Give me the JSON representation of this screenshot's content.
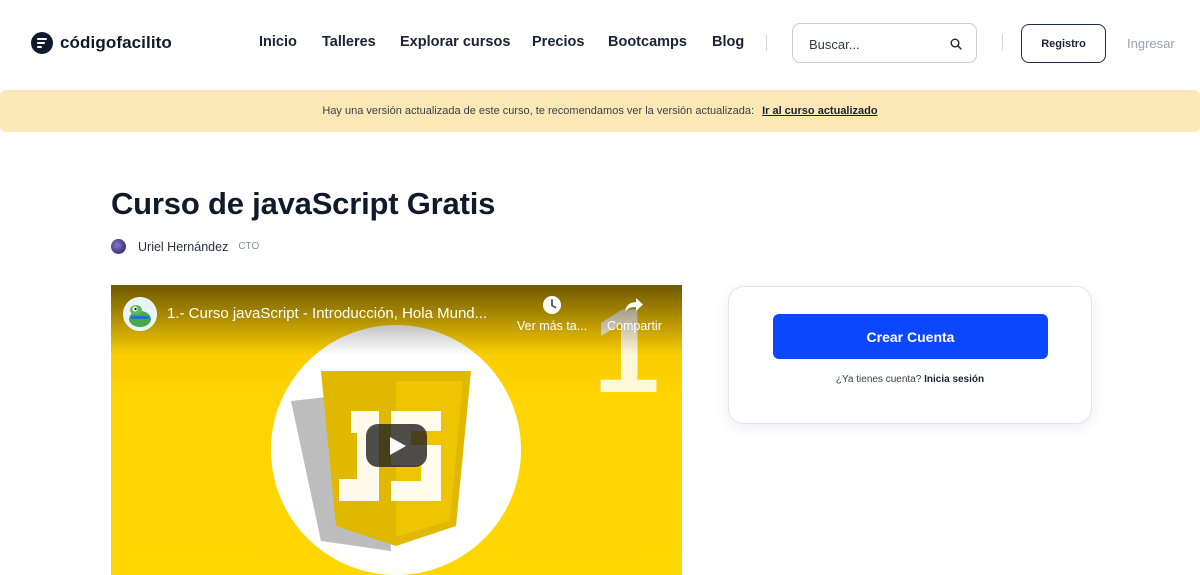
{
  "brand": {
    "name": "códigofacilito"
  },
  "nav": {
    "items": [
      "Inicio",
      "Talleres",
      "Explorar cursos",
      "Precios",
      "Bootcamps",
      "Blog"
    ]
  },
  "search": {
    "placeholder": "Buscar..."
  },
  "auth": {
    "register_label": "Registro",
    "login_label": "Ingresar"
  },
  "banner": {
    "message": "Hay una versión actualizada de este curso, te recomendamos ver la versión actualizada:",
    "link_label": "Ir al curso actualizado",
    "background": "#fbe8b6"
  },
  "course": {
    "title": "Curso de javaScript Gratis",
    "author_name": "Uriel Hernández",
    "author_role": "CTO"
  },
  "video": {
    "title": "1.- Curso javaScript - Introducción, Hola Mund...",
    "watch_later_label": "Ver más ta...",
    "share_label": "Compartir",
    "episode_number": "1",
    "background": "#ffd400"
  },
  "signup_card": {
    "cta_label": "Crear Cuenta",
    "login_prompt": "¿Ya tienes cuenta?",
    "login_link": "Inicia sesión",
    "cta_color": "#0a47ff"
  },
  "icons": [
    "logo-icon",
    "search-icon",
    "author-avatar",
    "channel-avatar",
    "clock-icon",
    "share-icon",
    "play-icon"
  ]
}
